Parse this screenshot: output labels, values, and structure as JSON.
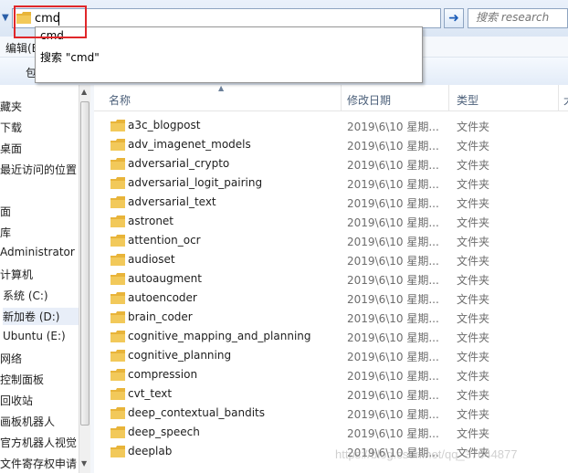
{
  "address_bar": {
    "value": "cmd",
    "go_label": "➜",
    "search_placeholder": "搜索 research"
  },
  "autocomplete": {
    "items": [
      "cmd",
      "搜索 \"cmd\""
    ]
  },
  "menubar": {
    "label": "编辑(E)"
  },
  "toolbar": {
    "label": "包"
  },
  "sidebar": {
    "items": [
      "藏夹",
      "下载",
      "桌面",
      "最近访问的位置",
      "面",
      "库",
      "Administrator",
      "计算机",
      "系统 (C:)",
      "新加卷 (D:)",
      "Ubuntu (E:)",
      "网络",
      "控制面板",
      "回收站",
      "画板机器人",
      "官方机器人视觉",
      "文件寄存权申请"
    ]
  },
  "columns": {
    "name": "名称",
    "date": "修改日期",
    "type": "类型",
    "size": "大"
  },
  "files": [
    {
      "name": "a3c_blogpost",
      "date": "2019\\6\\10 星期...",
      "type": "文件夹"
    },
    {
      "name": "adv_imagenet_models",
      "date": "2019\\6\\10 星期...",
      "type": "文件夹"
    },
    {
      "name": "adversarial_crypto",
      "date": "2019\\6\\10 星期...",
      "type": "文件夹"
    },
    {
      "name": "adversarial_logit_pairing",
      "date": "2019\\6\\10 星期...",
      "type": "文件夹"
    },
    {
      "name": "adversarial_text",
      "date": "2019\\6\\10 星期...",
      "type": "文件夹"
    },
    {
      "name": "astronet",
      "date": "2019\\6\\10 星期...",
      "type": "文件夹"
    },
    {
      "name": "attention_ocr",
      "date": "2019\\6\\10 星期...",
      "type": "文件夹"
    },
    {
      "name": "audioset",
      "date": "2019\\6\\10 星期...",
      "type": "文件夹"
    },
    {
      "name": "autoaugment",
      "date": "2019\\6\\10 星期...",
      "type": "文件夹"
    },
    {
      "name": "autoencoder",
      "date": "2019\\6\\10 星期...",
      "type": "文件夹"
    },
    {
      "name": "brain_coder",
      "date": "2019\\6\\10 星期...",
      "type": "文件夹"
    },
    {
      "name": "cognitive_mapping_and_planning",
      "date": "2019\\6\\10 星期...",
      "type": "文件夹"
    },
    {
      "name": "cognitive_planning",
      "date": "2019\\6\\10 星期...",
      "type": "文件夹"
    },
    {
      "name": "compression",
      "date": "2019\\6\\10 星期...",
      "type": "文件夹"
    },
    {
      "name": "cvt_text",
      "date": "2019\\6\\10 星期...",
      "type": "文件夹"
    },
    {
      "name": "deep_contextual_bandits",
      "date": "2019\\6\\10 星期...",
      "type": "文件夹"
    },
    {
      "name": "deep_speech",
      "date": "2019\\6\\10 星期...",
      "type": "文件夹"
    },
    {
      "name": "deeplab",
      "date": "2019\\6\\10 星期...",
      "type": "文件夹"
    }
  ],
  "watermark": "https://blog.csdn.net/qq_37644877",
  "colors": {
    "highlight_border": "#e0272a",
    "folder": "#e8b43a",
    "go_arrow": "#1c5db8"
  }
}
